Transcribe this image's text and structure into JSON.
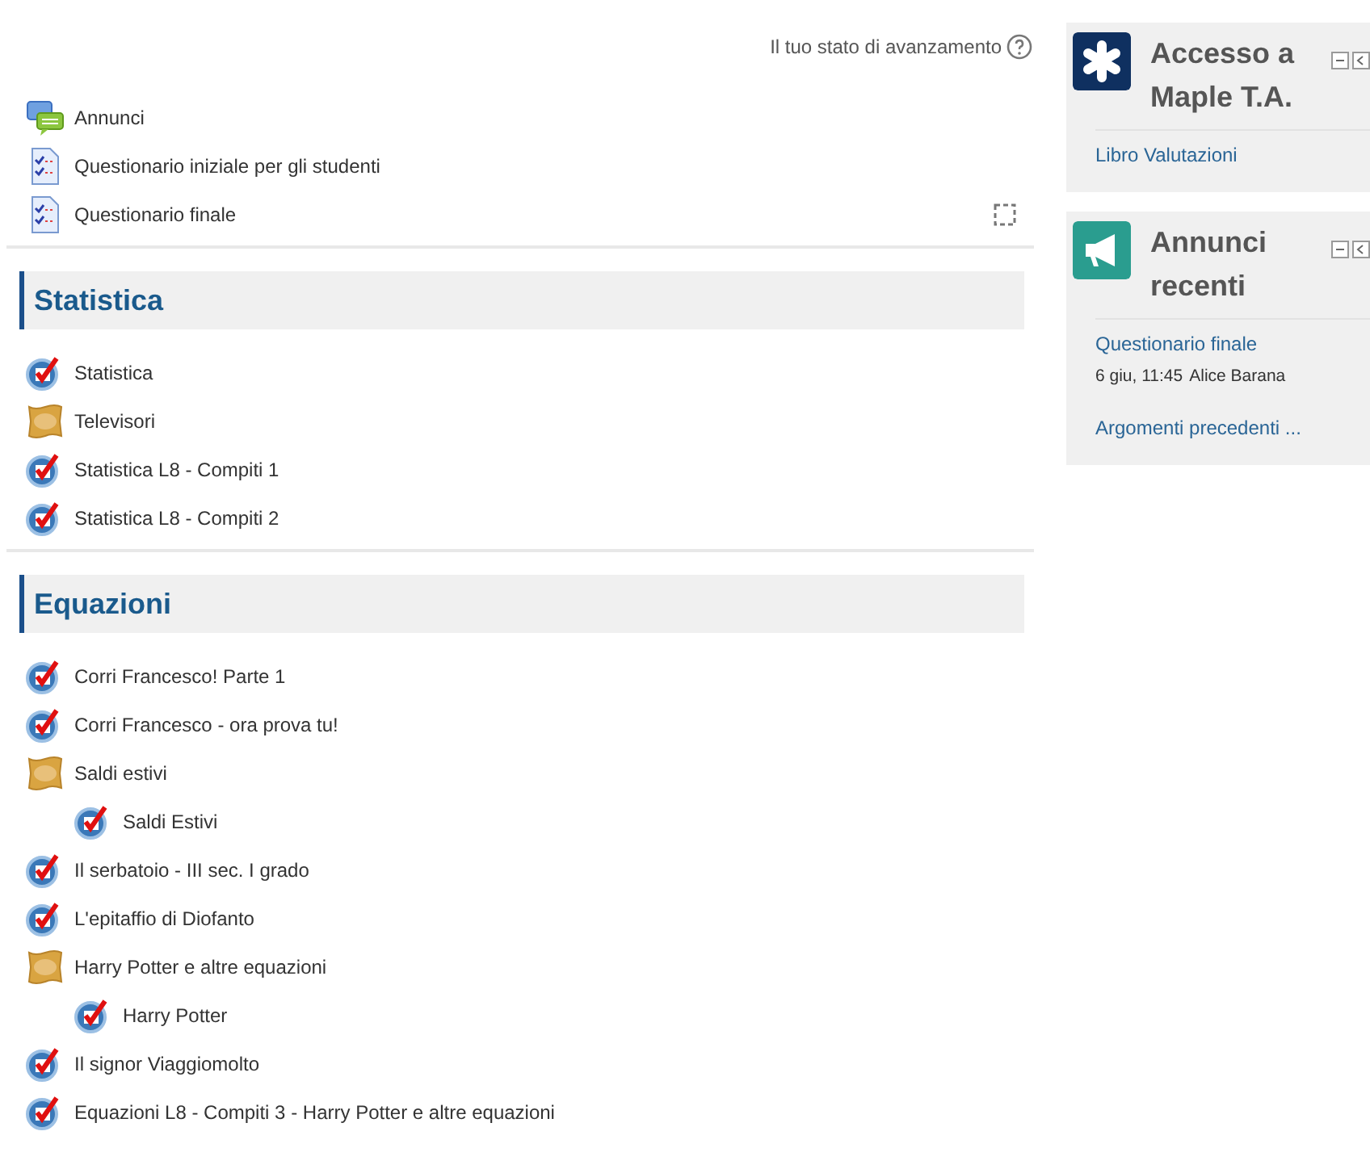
{
  "progress_label": "Il tuo stato di avanzamento",
  "intro": [
    {
      "kind": "forum",
      "title": "Annunci"
    },
    {
      "kind": "quiz",
      "title": "Questionario iniziale per gli studenti"
    },
    {
      "kind": "quiz",
      "title": "Questionario finale",
      "completion": {
        "checked": false
      }
    }
  ],
  "sections": [
    {
      "title": "Statistica",
      "items": [
        {
          "kind": "maple",
          "title": "Statistica"
        },
        {
          "kind": "lesson",
          "title": "Televisori"
        },
        {
          "kind": "maple",
          "title": "Statistica L8 - Compiti 1"
        },
        {
          "kind": "maple",
          "title": "Statistica L8 - Compiti 2"
        }
      ]
    },
    {
      "title": "Equazioni",
      "items": [
        {
          "kind": "maple",
          "title": "Corri Francesco! Parte 1"
        },
        {
          "kind": "maple",
          "title": "Corri Francesco - ora prova tu!"
        },
        {
          "kind": "lesson",
          "title": "Saldi estivi",
          "children": [
            {
              "kind": "maple",
              "title": "Saldi Estivi"
            }
          ]
        },
        {
          "kind": "maple",
          "title": "Il serbatoio - III sec. I grado"
        },
        {
          "kind": "maple",
          "title": "L'epitaffio di Diofanto"
        },
        {
          "kind": "lesson",
          "title": "Harry Potter e altre equazioni",
          "children": [
            {
              "kind": "maple",
              "title": "Harry Potter"
            }
          ]
        },
        {
          "kind": "maple",
          "title": "Il signor Viaggiomolto"
        },
        {
          "kind": "maple",
          "title": "Equazioni L8 - Compiti 3 - Harry Potter e altre equazioni"
        }
      ]
    }
  ],
  "blocks": [
    {
      "kind": "maple",
      "title": "Accesso a Maple T.A.",
      "links": [
        {
          "text": "Libro Valutazioni"
        }
      ]
    },
    {
      "kind": "news",
      "title": "Annunci recenti",
      "posts": [
        {
          "title": "Questionario finale",
          "date": "6 giu, 11:45",
          "author": "Alice Barana"
        }
      ],
      "links": [
        {
          "text": "Argomenti precedenti ..."
        }
      ]
    }
  ]
}
